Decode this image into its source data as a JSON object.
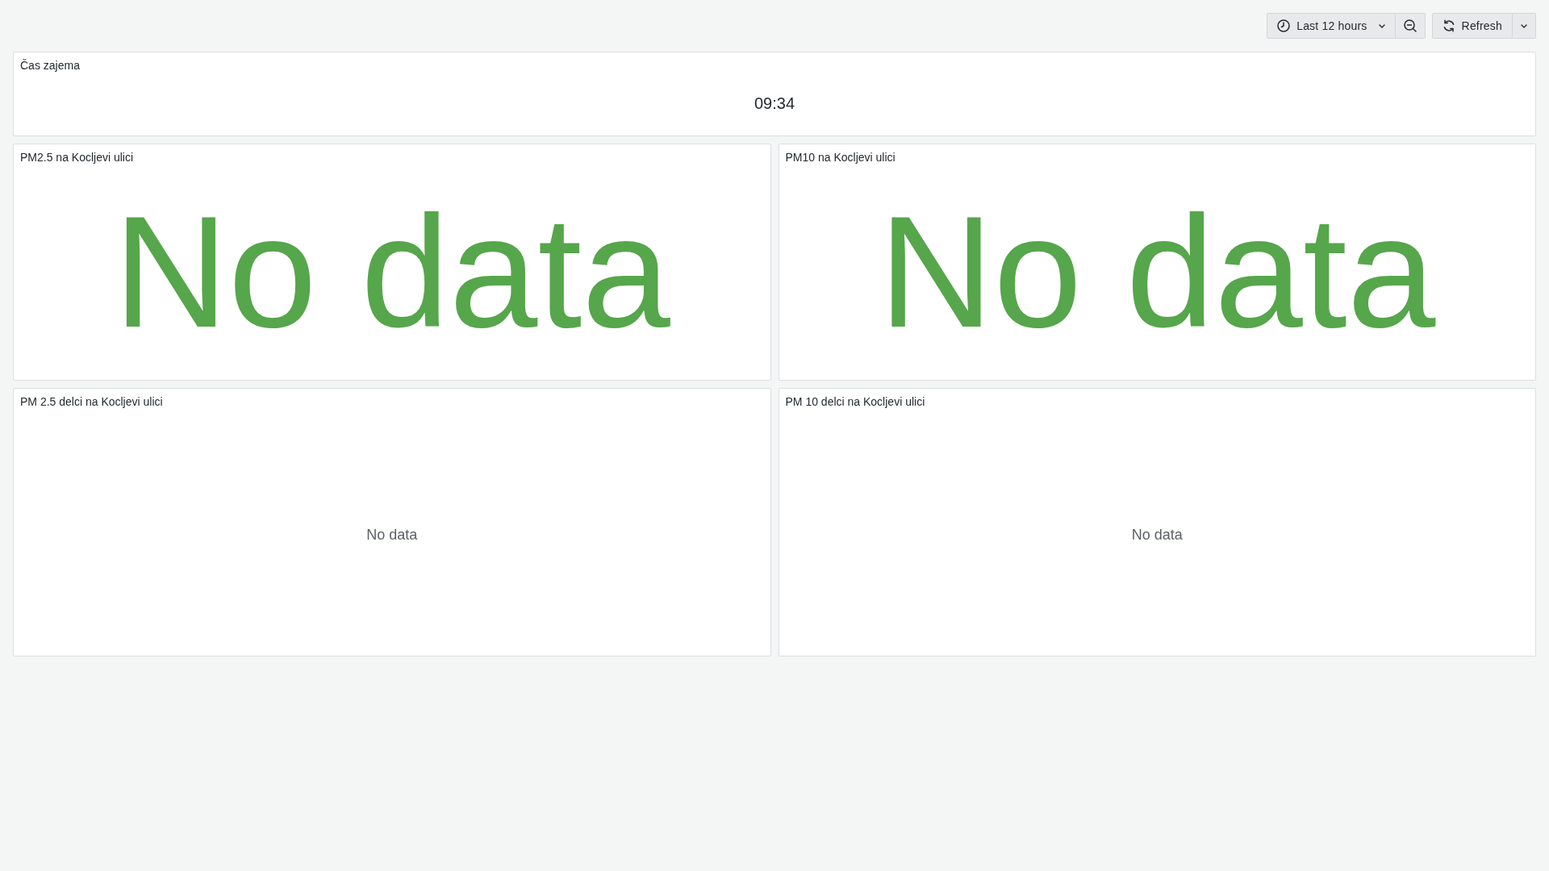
{
  "toolbar": {
    "time_range": {
      "label": "Last 12 hours"
    },
    "refresh": {
      "label": "Refresh"
    }
  },
  "rows": [
    {
      "panels": [
        {
          "kind": "stat",
          "title": "Čas zajema",
          "value": "09:34"
        }
      ]
    },
    {
      "panels": [
        {
          "kind": "big_stat",
          "title": "PM2.5 na Kocljevi ulici",
          "value": "No data"
        },
        {
          "kind": "big_stat",
          "title": "PM10 na Kocljevi ulici",
          "value": "No data"
        }
      ]
    },
    {
      "panels": [
        {
          "kind": "graph",
          "title": "PM 2.5 delci na Kocljevi ulici",
          "message": "No data"
        },
        {
          "kind": "graph",
          "title": "PM 10 delci na Kocljevi ulici",
          "message": "No data"
        }
      ]
    }
  ]
}
